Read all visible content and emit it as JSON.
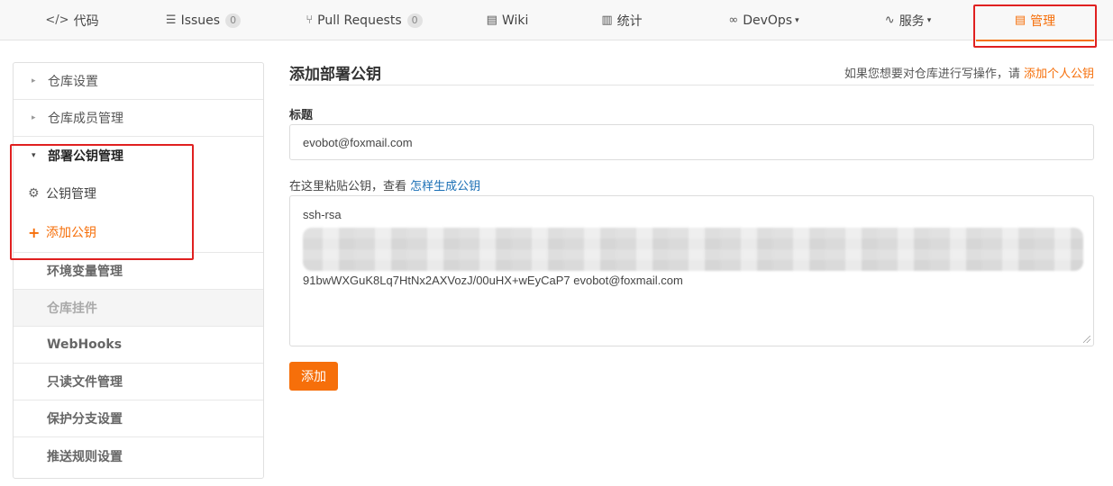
{
  "top_tabs": [
    {
      "label": "代码",
      "icon": "code-icon",
      "glyph": "</>"
    },
    {
      "label": "Issues",
      "icon": "issues-icon",
      "glyph": "☰",
      "badge": "0"
    },
    {
      "label": "Pull Requests",
      "icon": "pull-request-icon",
      "glyph": "⑂",
      "badge": "0"
    },
    {
      "label": "Wiki",
      "icon": "wiki-icon",
      "glyph": "▤"
    },
    {
      "label": "统计",
      "icon": "stats-icon",
      "glyph": "▥"
    },
    {
      "label": "DevOps",
      "icon": "devops-icon",
      "glyph": "∞",
      "caret": "▾"
    },
    {
      "label": "服务",
      "icon": "service-icon",
      "glyph": "∿",
      "caret": "▾"
    },
    {
      "label": "管理",
      "icon": "manage-icon",
      "glyph": "▤"
    }
  ],
  "sidebar": {
    "items": [
      {
        "label": "仓库设置"
      },
      {
        "label": "仓库成员管理"
      },
      {
        "label": "部署公钥管理"
      },
      {
        "label": "公钥管理",
        "icon": "gear-icon",
        "glyph": "⚙"
      },
      {
        "label": "添加公钥",
        "icon": "plus-icon",
        "glyph": "+"
      },
      {
        "label": "环境变量管理"
      },
      {
        "label": "仓库挂件"
      },
      {
        "label": "WebHooks"
      },
      {
        "label": "只读文件管理"
      },
      {
        "label": "保护分支设置"
      },
      {
        "label": "推送规则设置"
      }
    ],
    "arrow_closed": "▸",
    "arrow_open": "▾"
  },
  "main": {
    "title": "添加部署公钥",
    "hint_prefix": "如果您想要对仓库进行写操作，请 ",
    "hint_link": "添加个人公钥",
    "title_label": "标题",
    "title_value": "evobot@foxmail.com",
    "key_label_prefix": "在这里粘贴公钥，查看 ",
    "key_label_link": "怎样生成公钥",
    "key_line_first": "ssh-rsa",
    "key_line_last": "91bwWXGuK8Lq7HtNx2AXVozJ/00uHX+wEyCaP7 evobot@foxmail.com",
    "submit_label": "添加"
  },
  "colors": {
    "accent": "#f66f0a",
    "link": "#1a6fb5",
    "highlight_box": "#e02020"
  }
}
